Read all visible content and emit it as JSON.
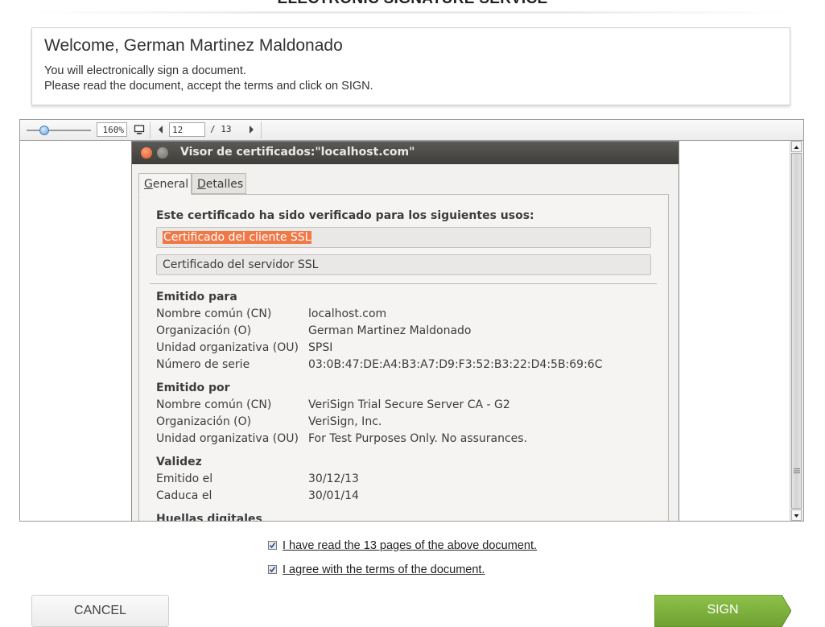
{
  "header": {
    "service_title": "ELECTRONIC SIGNATURE SERVICE"
  },
  "welcome": {
    "heading": "Welcome, German Martinez Maldonado",
    "line1": "You will electronically sign a document.",
    "line2": "Please read the document, accept the terms and click on SIGN."
  },
  "viewer": {
    "zoom": "160%",
    "current_page": "12",
    "total_pages": "/ 13"
  },
  "dialog": {
    "title": "Visor de certificados:\"localhost.com\"",
    "tabs": [
      {
        "label_ul": "G",
        "label_rest": "eneral"
      },
      {
        "label_ul": "D",
        "label_rest": "etalles"
      }
    ],
    "usage_title": "Este certificado ha sido verificado para los siguientes usos:",
    "usages": [
      "Certificado del cliente SSL",
      "Certificado del servidor SSL"
    ],
    "issued_to": {
      "heading": "Emitido para",
      "rows": [
        {
          "label": "Nombre común (CN)",
          "value": "localhost.com"
        },
        {
          "label": "Organización (O)",
          "value": "German Martinez Maldonado"
        },
        {
          "label": "Unidad organizativa (OU)",
          "value": "SPSI"
        },
        {
          "label": "Número de serie",
          "value": "03:0B:47:DE:A4:B3:A7:D9:F3:52:B3:22:D4:5B:69:6C"
        }
      ]
    },
    "issued_by": {
      "heading": "Emitido por",
      "rows": [
        {
          "label": "Nombre común (CN)",
          "value": "VeriSign Trial Secure Server CA - G2"
        },
        {
          "label": "Organización (O)",
          "value": "VeriSign, Inc."
        },
        {
          "label": "Unidad organizativa (OU)",
          "value": "For Test Purposes Only.  No assurances."
        }
      ]
    },
    "validity": {
      "heading": "Validez",
      "rows": [
        {
          "label": "Emitido el",
          "value": "30/12/13"
        },
        {
          "label": "Caduca el",
          "value": "30/01/14"
        }
      ]
    },
    "fingerprints_heading": "Huellas digitales"
  },
  "checks": {
    "read_label": "I have read the 13 pages of the above document.",
    "agree_label": "I agree with the terms of the document.",
    "read_checked": true,
    "agree_checked": true
  },
  "buttons": {
    "cancel": "CANCEL",
    "sign": "SIGN"
  },
  "colors": {
    "sign_green": "#7bb03a",
    "selection_orange": "#f07746",
    "titlebar_dark": "#3f3e3a"
  }
}
